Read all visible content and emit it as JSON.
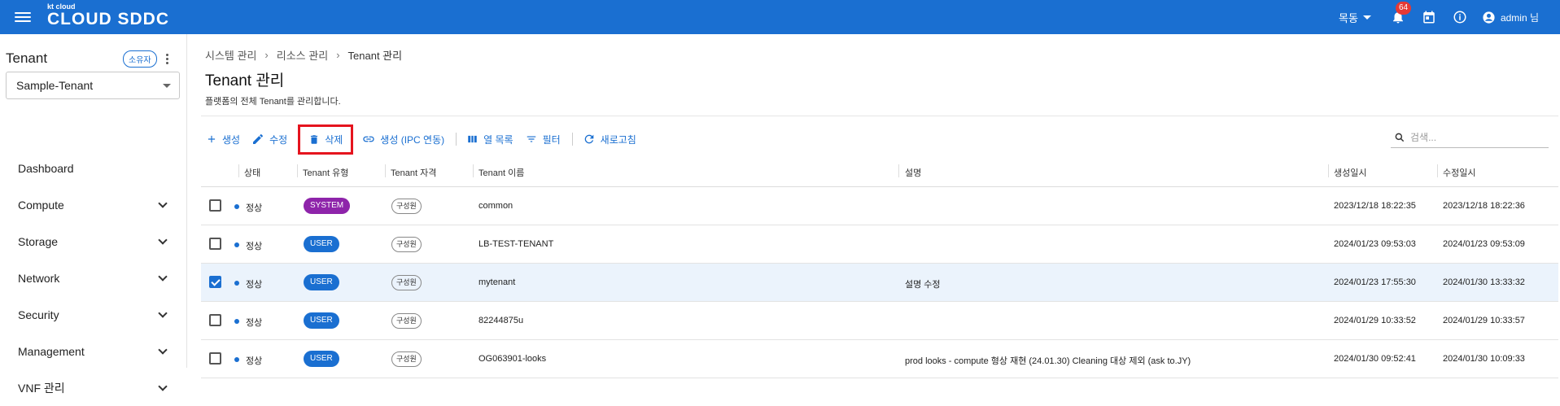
{
  "header": {
    "logo_small": "kt cloud",
    "logo_main": "CLOUD SDDC",
    "region": "목동",
    "notification_count": "64",
    "user": "admin 님"
  },
  "sidebar": {
    "tenant_title": "Tenant",
    "owner_chip": "소유자",
    "tenant_selected": "Sample-Tenant",
    "items": [
      {
        "label": "Dashboard",
        "expandable": false
      },
      {
        "label": "Compute",
        "expandable": true
      },
      {
        "label": "Storage",
        "expandable": true
      },
      {
        "label": "Network",
        "expandable": true
      },
      {
        "label": "Security",
        "expandable": true
      },
      {
        "label": "Management",
        "expandable": true
      },
      {
        "label": "VNF 관리",
        "expandable": true
      }
    ]
  },
  "main": {
    "breadcrumb": [
      "시스템 관리",
      "리소스 관리",
      "Tenant 관리"
    ],
    "title": "Tenant 관리",
    "description": "플랫폼의 전체 Tenant를 관리합니다.",
    "toolbar": {
      "create": "생성",
      "edit": "수정",
      "delete": "삭제",
      "create_ipc": "생성 (IPC 연동)",
      "columns": "열 목록",
      "filter": "필터",
      "refresh": "새로고침"
    },
    "search_placeholder": "검색...",
    "columns": [
      "상태",
      "Tenant 유형",
      "Tenant 자격",
      "Tenant 이름",
      "설명",
      "생성일시",
      "수정일시"
    ],
    "rows": [
      {
        "status": "정상",
        "type": "SYSTEM",
        "role": "구성원",
        "name": "common",
        "desc": "",
        "created": "2023/12/18 18:22:35",
        "modified": "2023/12/18 18:22:36",
        "checked": false
      },
      {
        "status": "정상",
        "type": "USER",
        "role": "구성원",
        "name": "LB-TEST-TENANT",
        "desc": "",
        "created": "2024/01/23 09:53:03",
        "modified": "2024/01/23 09:53:09",
        "checked": false
      },
      {
        "status": "정상",
        "type": "USER",
        "role": "구성원",
        "name": "mytenant",
        "desc": "설명 수정",
        "created": "2024/01/23 17:55:30",
        "modified": "2024/01/30 13:33:32",
        "checked": true
      },
      {
        "status": "정상",
        "type": "USER",
        "role": "구성원",
        "name": "82244875u",
        "desc": "",
        "created": "2024/01/29 10:33:52",
        "modified": "2024/01/29 10:33:57",
        "checked": false
      },
      {
        "status": "정상",
        "type": "USER",
        "role": "구성원",
        "name": "OG063901-looks",
        "desc": "prod looks - compute 형상 재현 (24.01.30) Cleaning 대상 제외 (ask to.JY)",
        "created": "2024/01/30 09:52:41",
        "modified": "2024/01/30 10:09:33",
        "checked": false
      }
    ]
  },
  "colors": {
    "brand": "#1a6fd1",
    "system_pill": "#8e24aa",
    "highlight": "#e5141e",
    "badge": "#e53935"
  }
}
